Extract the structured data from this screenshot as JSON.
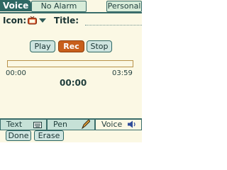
{
  "header": {
    "title": "Voice",
    "alarm_label": "No Alarm",
    "category_label": "Personal"
  },
  "form": {
    "icon_label": "Icon:",
    "title_label": "Title:"
  },
  "controls": {
    "play_label": "Play",
    "rec_label": "Rec",
    "stop_label": "Stop"
  },
  "playback": {
    "start_time": "00:00",
    "end_time": "03:59",
    "current_time": "00:00",
    "progress_fraction": 0.0
  },
  "tabs": {
    "text_label": "Text",
    "pen_label": "Pen",
    "voice_label": "Voice"
  },
  "footer": {
    "done_label": "Done",
    "erase_label": "Erase"
  },
  "colors": {
    "accent": "#2f6864",
    "rec_button": "#c85f1c",
    "background": "#fbf8e4"
  }
}
